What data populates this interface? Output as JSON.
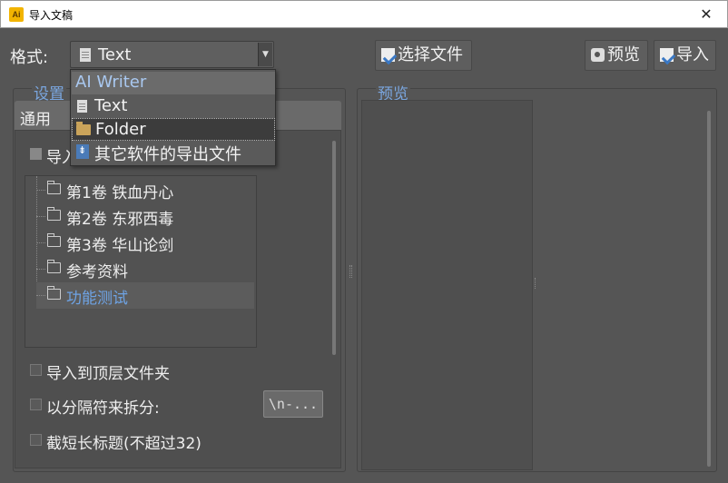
{
  "window": {
    "title": "导入文稿",
    "app_icon_text": "Ai",
    "close_glyph": "✕"
  },
  "format": {
    "label": "格式:",
    "selected": "Text",
    "options": [
      {
        "label": "AI Writer"
      },
      {
        "label": "Text"
      },
      {
        "label": "Folder"
      },
      {
        "label": "其它软件的导出文件"
      }
    ]
  },
  "toolbar": {
    "select_file": "选择文件",
    "preview": "预览",
    "import": "导入"
  },
  "settings": {
    "group_title": "设置",
    "tab": "通用",
    "import_checkbox_label": "导入",
    "tree": [
      {
        "label": "第1卷 铁血丹心"
      },
      {
        "label": "第2卷 东邪西毒"
      },
      {
        "label": "第3卷 华山论剑"
      },
      {
        "label": "参考资料"
      },
      {
        "label": "功能测试"
      }
    ],
    "import_to_top": "导入到顶层文件夹",
    "split_by_separator": "以分隔符来拆分:",
    "separator_value": "\\n-...",
    "truncate_title": "截短长标题(不超过32)"
  },
  "preview": {
    "group_title": "预览"
  },
  "colors": {
    "accent": "#7aa6df",
    "selected_tree": "#6ea3e4",
    "background": "#555555"
  }
}
